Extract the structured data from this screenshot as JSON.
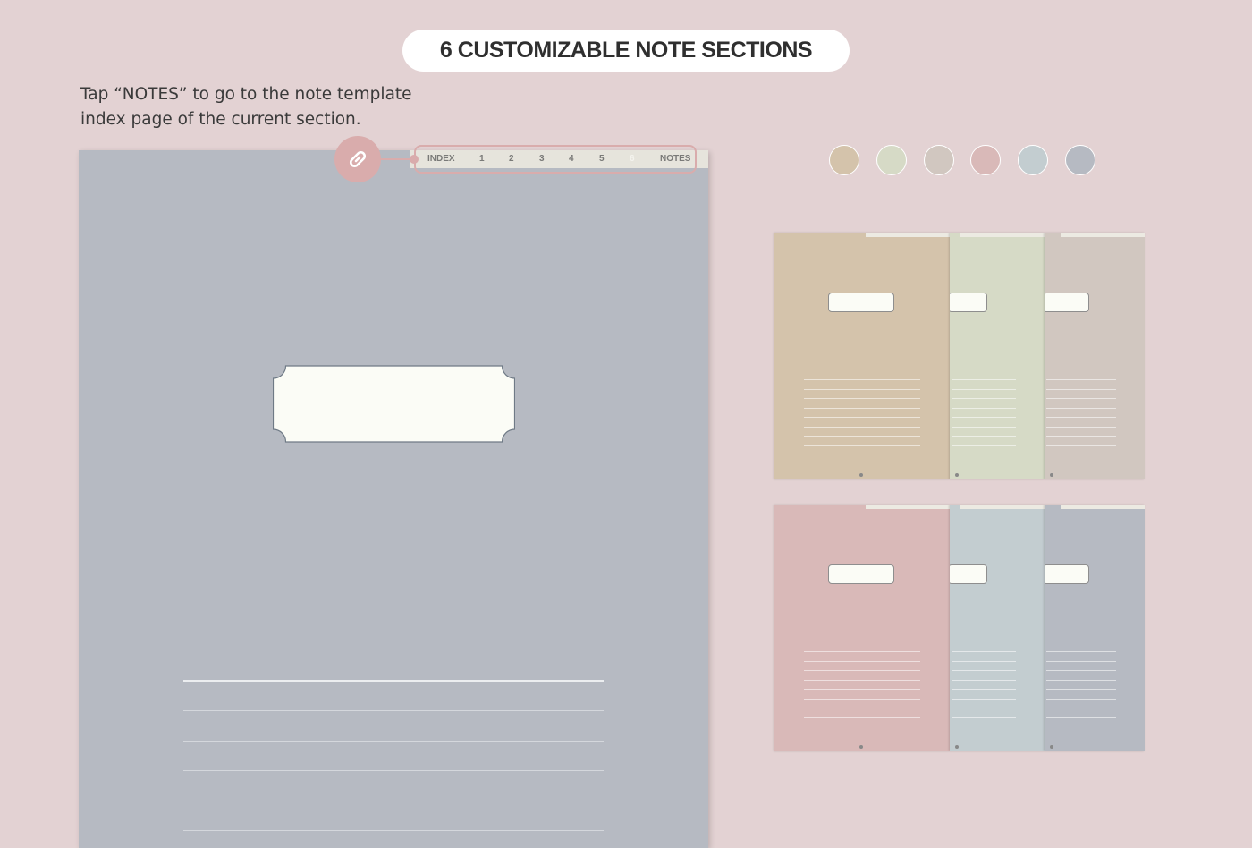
{
  "header": {
    "title": "6 CUSTOMIZABLE NOTE SECTIONS"
  },
  "instruction": {
    "line1": "Tap “NOTES” to go to the note template",
    "line2": "index page of the current section."
  },
  "tabs": [
    {
      "label": "INDEX",
      "active": false
    },
    {
      "label": "1",
      "active": false
    },
    {
      "label": "2",
      "active": false
    },
    {
      "label": "3",
      "active": false
    },
    {
      "label": "4",
      "active": false
    },
    {
      "label": "5",
      "active": false
    },
    {
      "label": "6",
      "active": true
    },
    {
      "label": "NOTES",
      "active": false
    }
  ],
  "icons": {
    "link": "link-icon"
  },
  "colors": {
    "background": "#e3d2d3",
    "accent": "#d9acac",
    "page_big": "#b6bac2",
    "label_fill": "#fbfcf6"
  },
  "swatches": [
    "#d4c3ab",
    "#d6dac6",
    "#d1c7c0",
    "#d9b9b8",
    "#c3cdd0",
    "#b6bac2"
  ],
  "mini_rows": [
    {
      "colors": [
        "#d4c3ab",
        "#d6dac6",
        "#d1c7c0"
      ]
    },
    {
      "colors": [
        "#d9b9b8",
        "#c3cdd0",
        "#b6bac2"
      ]
    }
  ]
}
